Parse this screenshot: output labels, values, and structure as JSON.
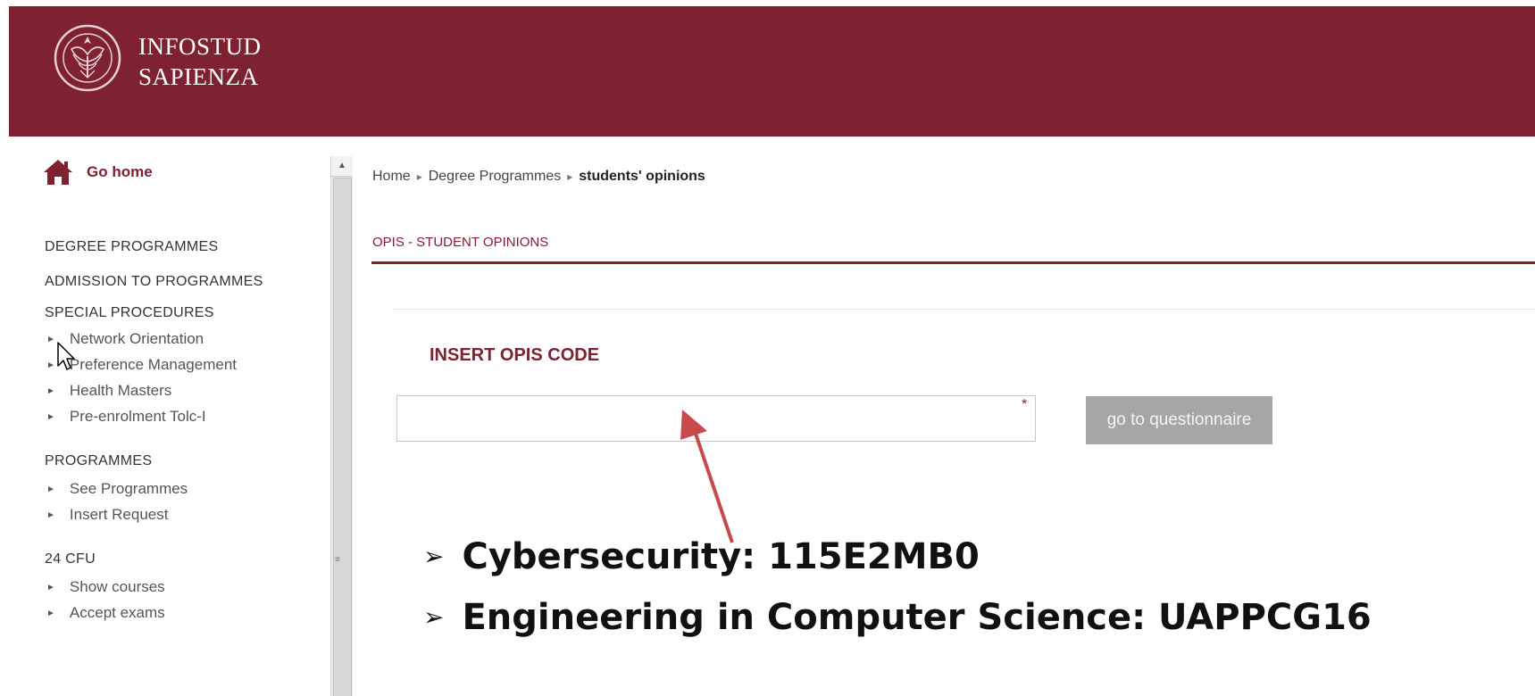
{
  "header": {
    "brand_line1": "INFOSTUD",
    "brand_line2": "SAPIENZA",
    "color": "#7e2131"
  },
  "sidebar": {
    "home_label": "Go home",
    "sections": [
      {
        "title": "DEGREE PROGRAMMES",
        "items": []
      },
      {
        "title": "ADMISSION TO PROGRAMMES",
        "items": []
      },
      {
        "title": "SPECIAL PROCEDURES",
        "items": [
          "Network Orientation",
          "Preference Management",
          "Health Masters",
          "Pre-enrolment Tolc-I"
        ]
      },
      {
        "title": "PROGRAMMES",
        "items": [
          "See Programmes",
          "Insert Request"
        ]
      },
      {
        "title": "24 CFU",
        "items": [
          "Show courses",
          "Accept exams"
        ]
      }
    ]
  },
  "breadcrumb": {
    "home": "Home",
    "degree": "Degree Programmes",
    "current": "students' opinions"
  },
  "main": {
    "section_title": "OPIS - STUDENT OPINIONS",
    "insert_label": "INSERT OPIS CODE",
    "input_value": "",
    "required_mark": "*",
    "button_label": "go to questionnaire"
  },
  "codes": [
    "Cybersecurity: 115E2MB0",
    "Engineering in Computer Science: UAPPCG16"
  ],
  "bullet_glyph": "➢",
  "icons": {
    "home": "home-icon",
    "cursor": "mouse-cursor-icon",
    "arrow": "annotation-arrow-icon",
    "logo": "sapienza-seal-logo"
  }
}
